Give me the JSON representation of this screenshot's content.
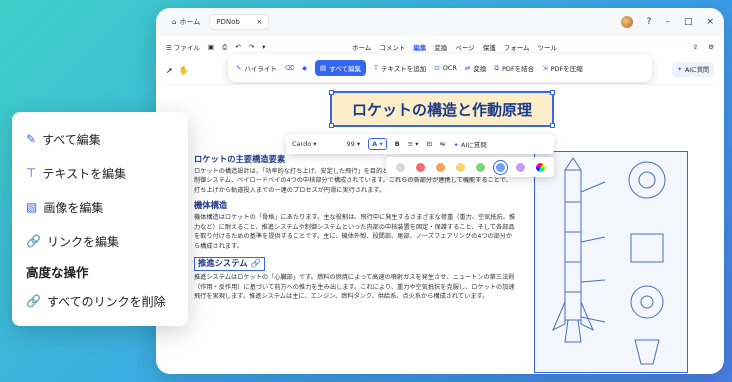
{
  "titlebar": {
    "home_tab": "ホーム",
    "doc_tab": "PDNob"
  },
  "menubar": {
    "file": "ファイル",
    "tabs": [
      "ホーム",
      "コメント",
      "編集",
      "変換",
      "ページ",
      "保護",
      "フォーム",
      "ツール"
    ],
    "active": "編集"
  },
  "toolbar": {
    "highlight": "ハイライト",
    "edit_all": "すべて編集",
    "add_text": "テキストを追加",
    "ocr": "OCR",
    "convert": "変換",
    "merge": "PDFを結合",
    "compress": "PDFを圧縮",
    "ai": "AIに質問"
  },
  "doc": {
    "title": "ロケットの構造と作動原理",
    "sec1_h": "ロケットの主要構造要素",
    "sec1_p": "ロケットの構造設計は、「効率的な打ち上げ、安定した飛行」を目的としています。主に、機体構造、推進システム、制御システム、ペイロードベイの4つの中核部分で構成されています。これらの各部分が連携して機能することで、打ち上げから軌道投入までの一連のプロセスが円滑に実行されます。",
    "sec2_h": "機体構造",
    "sec2_p": "機体構造はロケットの「骨格」にあたります。主な役割は、飛行中に発生するさまざまな荷重（重力、空気抵抗、推力など）に耐えること、推進システムや制御システムといった内部の中核装置を固定・保護すること、そして各部品を取り付けるための基準を提供することです。主に、機体外殻、段間部、尾部、ノーズフェアリングの4つの部分から構成されます。",
    "sec3_h": "推進システム",
    "sec3_p": "推進システムはロケットの「心臓部」です。燃料の燃焼によって高速の噴射ガスを発生させ、ニュートンの第三法則（作用・反作用）に基づいて前方への推力を生み出します。これにより、重力や空気抵抗を克服し、ロケットの加速飛行を実現します。推進システムは主に、エンジン、燃料タンク、供給系、点火系から構成されています。"
  },
  "format": {
    "font": "Cardo",
    "size": "99",
    "ai": "AIに質問"
  },
  "colors": [
    "#d9d9d9",
    "#f26b6b",
    "#f5a35c",
    "#f5d76e",
    "#7cd67c",
    "#6fa3f5",
    "#c89af5"
  ],
  "sidepanel": {
    "items": [
      "すべて編集",
      "テキストを編集",
      "画像を編集",
      "リンクを編集"
    ],
    "advanced_head": "高度な操作",
    "advanced_item": "すべてのリンクを削除"
  }
}
